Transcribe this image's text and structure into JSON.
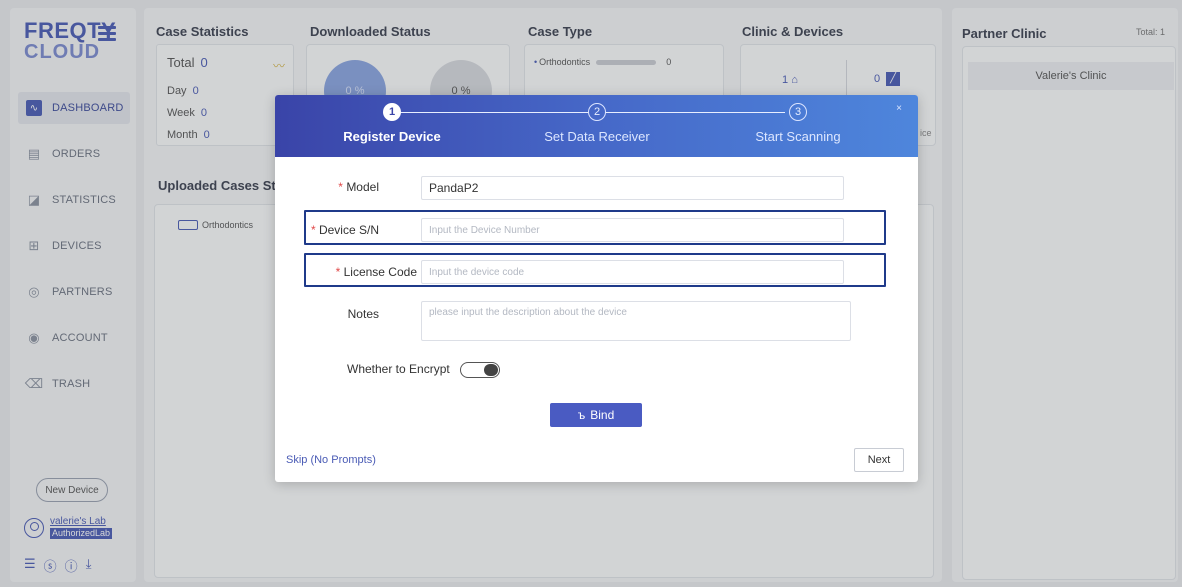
{
  "sidebar": {
    "logo_line1": "FREQTY",
    "logo_line2": "CLOUD",
    "items": [
      {
        "label": "DASHBOARD",
        "icon": "pulse-icon"
      },
      {
        "label": "ORDERS",
        "icon": "orders-icon"
      },
      {
        "label": "STATISTICS",
        "icon": "statistics-icon"
      },
      {
        "label": "DEVICES",
        "icon": "devices-icon"
      },
      {
        "label": "PARTNERS",
        "icon": "partners-icon"
      },
      {
        "label": "ACCOUNT",
        "icon": "account-icon"
      },
      {
        "label": "TRASH",
        "icon": "trash-icon"
      }
    ],
    "new_device": "New Device",
    "user_name": "valerie's Lab",
    "user_badge": "AuthorizedLab"
  },
  "dashboard": {
    "case_statistics": {
      "title": "Case Statistics",
      "total_label": "Total",
      "total": "0",
      "day_label": "Day",
      "day": "0",
      "week_label": "Week",
      "week": "0",
      "month_label": "Month",
      "month": "0"
    },
    "downloaded_status": {
      "title": "Downloaded Status",
      "pct1": "0 %",
      "pct2": "0 %"
    },
    "case_type": {
      "title": "Case Type",
      "row1_label": "Orthodontics",
      "row1_value": "0",
      "row2_value": "0"
    },
    "clinic_devices": {
      "title": "Clinic & Devices",
      "clinics": "1",
      "devices": "0",
      "device_suffix": "ice"
    },
    "partner_clinic": {
      "title": "Partner Clinic",
      "total": "Total: 1",
      "item": "Valerie's Clinic"
    },
    "uploaded_cases": {
      "title": "Uploaded Cases St",
      "legend": "Orthodontics"
    }
  },
  "modal": {
    "steps": [
      {
        "num": "1",
        "label": "Register Device"
      },
      {
        "num": "2",
        "label": "Set Data Receiver"
      },
      {
        "num": "3",
        "label": "Start Scanning"
      }
    ],
    "close": "×",
    "model_label": "Model",
    "model_value": "PandaP2",
    "sn_label": "Device S/N",
    "sn_placeholder": "Input the Device Number",
    "license_label": "License Code",
    "license_placeholder": "Input the device code",
    "notes_label": "Notes",
    "notes_placeholder": "please input the description about the device",
    "encrypt_label": "Whether to Encrypt",
    "bind_label": "Bind",
    "skip_label": "Skip (No Prompts)",
    "next_label": "Next"
  },
  "colors": {
    "brand": "#4a5bb5",
    "header_start": "#3a44a8",
    "header_end": "#4e86dc",
    "required": "#e04848"
  }
}
